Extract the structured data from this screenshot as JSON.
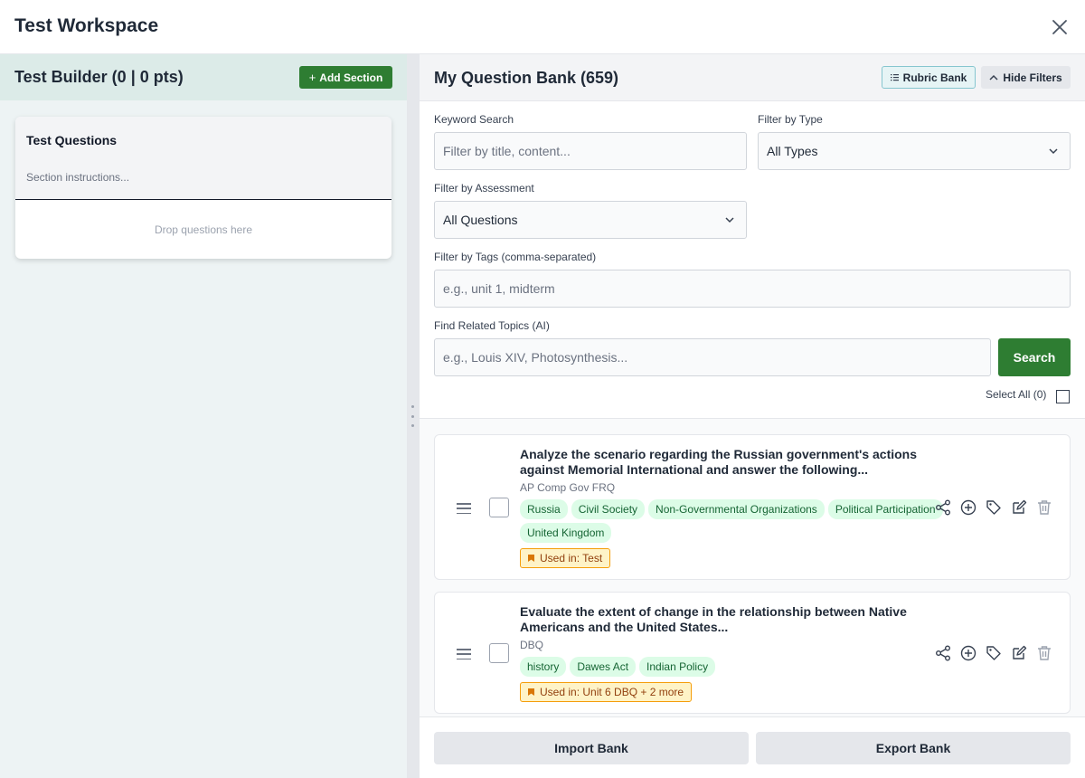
{
  "window": {
    "title": "Test Workspace"
  },
  "test_builder": {
    "title": "Test Builder (0 | 0 pts)",
    "add_section_label": "Add Section",
    "section": {
      "title": "Test Questions",
      "instructions_placeholder": "Section instructions...",
      "drop_hint": "Drop questions here"
    }
  },
  "bank": {
    "title": "My Question Bank (659)",
    "rubric_bank_label": "Rubric Bank",
    "hide_filters_label": "Hide Filters",
    "filters": {
      "keyword_label": "Keyword Search",
      "keyword_placeholder": "Filter by title, content...",
      "type_label": "Filter by Type",
      "type_value": "All Types",
      "assessment_label": "Filter by Assessment",
      "assessment_value": "All Questions",
      "tags_label": "Filter by Tags (comma-separated)",
      "tags_placeholder": "e.g., unit 1, midterm",
      "related_label": "Find Related Topics (AI)",
      "related_placeholder": "e.g., Louis XIV, Photosynthesis...",
      "search_label": "Search"
    },
    "select_all_label": "Select All (0)",
    "questions": [
      {
        "title": "Analyze the scenario regarding the Russian government's actions against Memorial International and answer the following...",
        "type": "AP Comp Gov FRQ",
        "tags": [
          "Russia",
          "Civil Society",
          "Non-Governmental Organizations",
          "Political Participation",
          "United Kingdom"
        ],
        "used_in": "Used in: Test"
      },
      {
        "title": "Evaluate the extent of change in the relationship between Native Americans and the United States...",
        "type": "DBQ",
        "tags": [
          "history",
          "Dawes Act",
          "Indian Policy"
        ],
        "used_in": "Used in: Unit 6 DBQ + 2 more"
      }
    ],
    "import_label": "Import Bank",
    "export_label": "Export Bank"
  },
  "icons": {
    "close": "close-icon",
    "rubric": "list-icon",
    "hide": "chevron-up-icon",
    "chevron_down": "chevron-down-icon",
    "grip": "drag-handle-icon",
    "actions": [
      "share-icon",
      "add-circle-icon",
      "tag-icon",
      "edit-icon",
      "trash-icon"
    ]
  },
  "colors": {
    "primary_green": "#2e7d32",
    "tag_bg": "#dcfce7",
    "tag_text": "#166534",
    "used_bg": "#fef3c7",
    "used_border": "#f59e0b"
  }
}
